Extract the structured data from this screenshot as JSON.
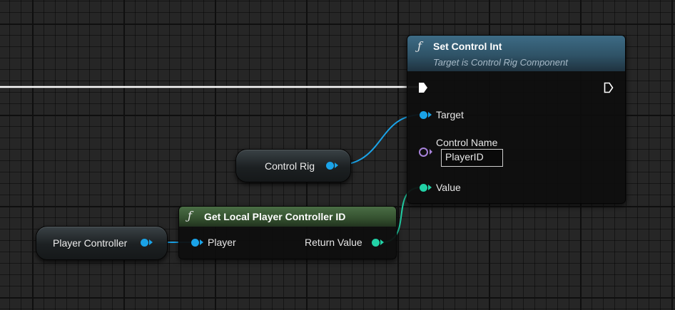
{
  "set_control_int": {
    "icon": "function-icon",
    "title": "Set Control Int",
    "subtitle": "Target is Control Rig Component",
    "pins": {
      "target": "Target",
      "control_name": "Control Name",
      "control_name_value": "PlayerID",
      "value": "Value"
    }
  },
  "get_local_player_controller_id": {
    "icon": "function-icon",
    "title": "Get Local Player Controller ID",
    "pins": {
      "player": "Player",
      "return_value": "Return Value"
    }
  },
  "control_rig_variable": {
    "label": "Control Rig"
  },
  "player_controller_variable": {
    "label": "Player Controller"
  },
  "colors": {
    "background": "#262626",
    "object_pin": "#1aa3e8",
    "int_pin": "#22d1a6",
    "name_pin": "#a782d9",
    "exec_pin": "#ffffff",
    "function_header_blue": "#3f6f8a",
    "function_header_green": "#3d5a3a"
  }
}
